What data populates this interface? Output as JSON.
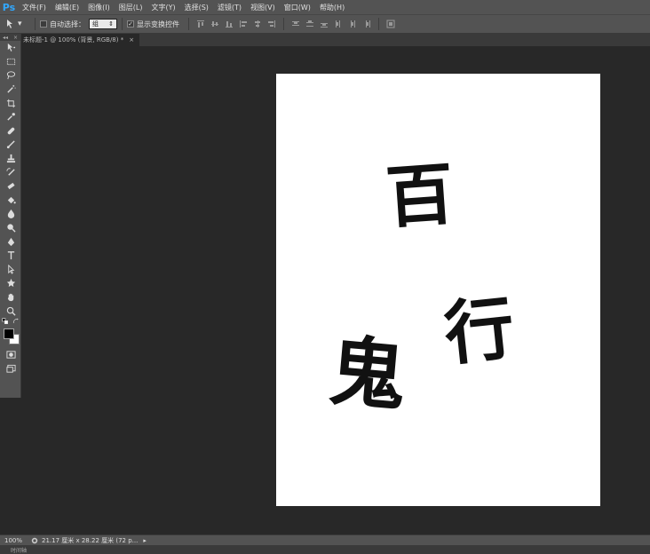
{
  "app": {
    "logo": "Ps"
  },
  "menu": [
    "文件(F)",
    "编辑(E)",
    "图像(I)",
    "图层(L)",
    "文字(Y)",
    "选择(S)",
    "滤镜(T)",
    "视图(V)",
    "窗口(W)",
    "帮助(H)"
  ],
  "options": {
    "auto_select_label": "自动选择：",
    "auto_select_value": "组",
    "show_transform_label": "显示变换控件"
  },
  "document": {
    "tab_title": "未标题-1 @ 100% (背景, RGB/8) *",
    "tab_close": "×"
  },
  "toolbox": {
    "collapse": "◂◂",
    "close": "×"
  },
  "canvas": {
    "glyph1": "百",
    "glyph2": "行",
    "glyph3": "鬼"
  },
  "status": {
    "zoom": "100%",
    "info": "21.17 厘米 x 28.22 厘米 (72 p..."
  },
  "panel": {
    "label": "时间轴"
  },
  "colors": {
    "foreground": "#000000",
    "background": "#ffffff"
  }
}
